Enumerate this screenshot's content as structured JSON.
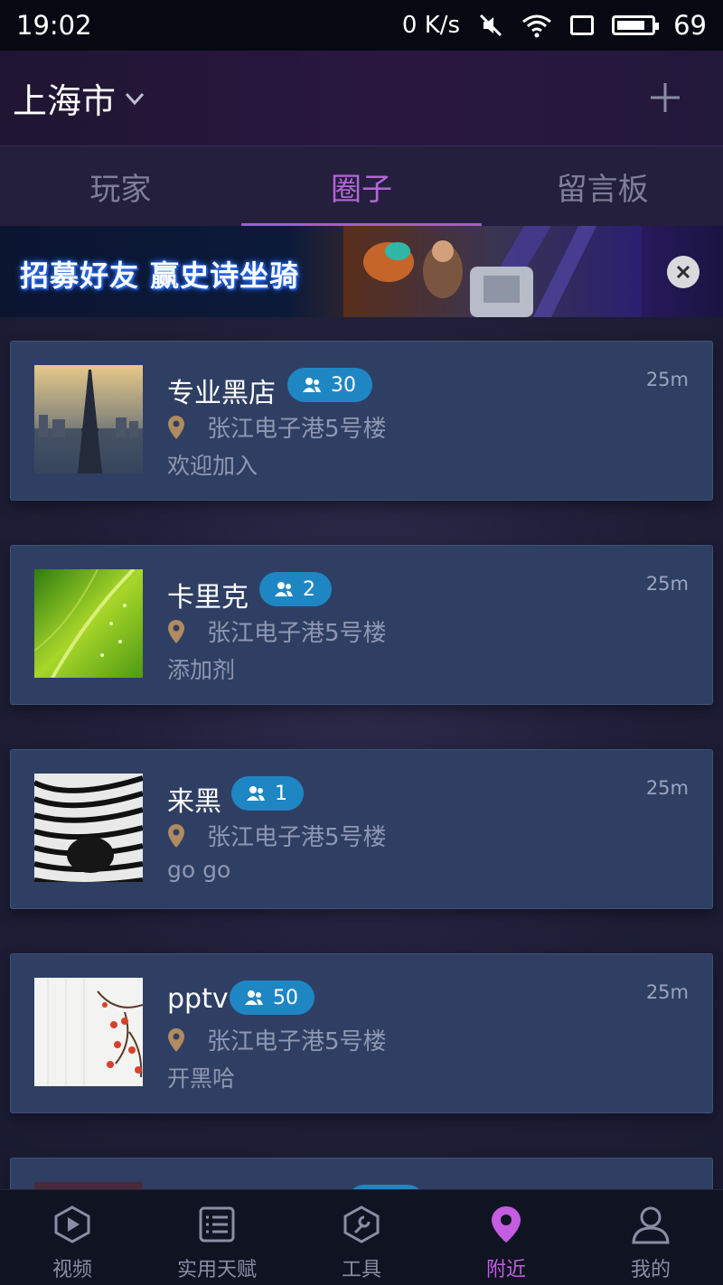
{
  "status_bar": {
    "time": "19:02",
    "net_speed": "0 K/s",
    "icons": [
      "mute-icon",
      "wifi-icon",
      "sim-icon",
      "battery-icon"
    ],
    "battery": "69"
  },
  "header": {
    "city": "上海市",
    "icons": [
      "chevron-down-icon",
      "add-icon"
    ]
  },
  "tabs": [
    {
      "label": "玩家",
      "active": false
    },
    {
      "label": "圈子",
      "active": true
    },
    {
      "label": "留言板",
      "active": false
    }
  ],
  "banner": {
    "text": "招募好友 赢史诗坐骑",
    "icon": "close-icon"
  },
  "circles": [
    {
      "name": "专业黑店",
      "members": "30",
      "distance": "25m",
      "address": "张江电子港5号楼",
      "desc": "欢迎加入",
      "thumb": "eiffel-tower"
    },
    {
      "name": "卡里克",
      "members": "2",
      "distance": "25m",
      "address": "张江电子港5号楼",
      "desc": "添加剂",
      "thumb": "green-leaf"
    },
    {
      "name": "来黑",
      "members": "1",
      "distance": "25m",
      "address": "张江电子港5号楼",
      "desc": "go go",
      "thumb": "zebra"
    },
    {
      "name": "pptv",
      "members": "50",
      "distance": "25m",
      "address": "张江电子港5号楼",
      "desc": "开黑哈",
      "thumb": "plum-blossom"
    }
  ],
  "bottom_nav": [
    {
      "label": "视频",
      "icon": "video-icon",
      "active": false
    },
    {
      "label": "实用天赋",
      "icon": "list-icon",
      "active": false
    },
    {
      "label": "工具",
      "icon": "wrench-icon",
      "active": false
    },
    {
      "label": "附近",
      "icon": "location-pin-icon",
      "active": true
    },
    {
      "label": "我的",
      "icon": "user-icon",
      "active": false
    }
  ],
  "colors": {
    "accent": "#b266d9",
    "card": "#2f3f63",
    "badge": "#1f86c4",
    "pin": "#b08a60"
  }
}
